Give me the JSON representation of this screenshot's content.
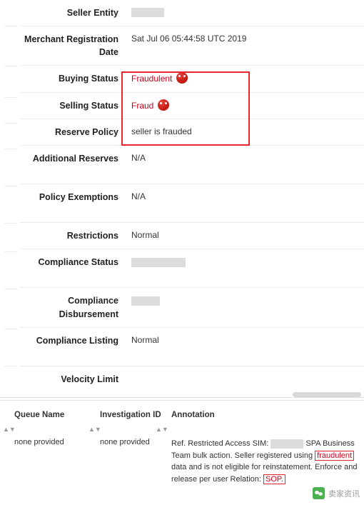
{
  "detail_rows": [
    {
      "label": "Seller Entity",
      "value": "",
      "redacted": true,
      "redact_width": 46,
      "style": "normal"
    },
    {
      "label": "Merchant Registration Date",
      "value": "Sat Jul 06 05:44:58 UTC 2019",
      "redacted": false,
      "style": "normal"
    },
    {
      "label": "Buying Status",
      "value": "Fraudulent",
      "redacted": false,
      "style": "red",
      "emoji": "angry-face-emoji"
    },
    {
      "label": "Selling Status",
      "value": "Fraud",
      "redacted": false,
      "style": "red",
      "emoji": "angry-face-emoji"
    },
    {
      "label": "Reserve Policy",
      "value": "seller is frauded",
      "redacted": false,
      "style": "normal"
    },
    {
      "label": "Additional Reserves",
      "value": "N/A",
      "redacted": false,
      "style": "normal"
    },
    {
      "label": "Policy Exemptions",
      "value": "N/A",
      "redacted": false,
      "style": "normal"
    },
    {
      "label": "Restrictions",
      "value": "Normal",
      "redacted": false,
      "style": "normal"
    },
    {
      "label": "Compliance Status",
      "value": "",
      "redacted": true,
      "redact_width": 76,
      "style": "normal"
    },
    {
      "label": "Compliance Disbursement",
      "value": "",
      "redacted": true,
      "redact_width": 40,
      "style": "normal"
    },
    {
      "label": "Compliance Listing",
      "value": "Normal",
      "redacted": false,
      "style": "normal"
    },
    {
      "label": "Velocity Limit",
      "value": "",
      "redacted": false,
      "style": "normal"
    }
  ],
  "highlight": {
    "color": "#e8262d",
    "covers_rows": [
      "Buying Status",
      "Selling Status",
      "Reserve Policy"
    ]
  },
  "bottom_table": {
    "headers": [
      "Queue Name",
      "Investigation ID",
      "Annotation"
    ],
    "row": {
      "queue_name": "none provided",
      "investigation_id": "none provided",
      "annotation_parts": [
        {
          "text": "Ref. Restricted Access SIM: ",
          "style": "normal"
        },
        {
          "text": "",
          "style": "redacted",
          "redact_width": 46
        },
        {
          "text": " SPA Business Team bulk action. Seller registered using ",
          "style": "normal"
        },
        {
          "text": "fraudulent",
          "style": "boxed"
        },
        {
          "text": " data and is not eligible for reinstatement. Enforce and release per user Relation: ",
          "style": "normal"
        },
        {
          "text": "SOP.",
          "style": "boxed"
        }
      ]
    }
  },
  "watermark": {
    "text": "卖家资讯",
    "logo": "green-app-logo"
  }
}
